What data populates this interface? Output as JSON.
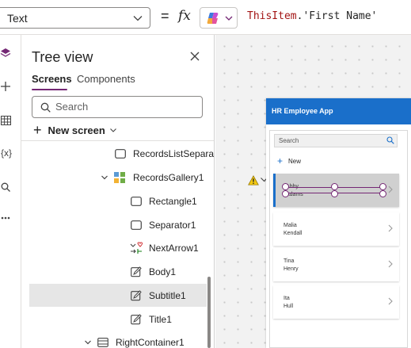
{
  "formula_bar": {
    "property": "Text",
    "equals": "=",
    "fx": "fx",
    "formula_keyword": "ThisItem",
    "formula_rest": ".'First Name'"
  },
  "rail": {
    "icons": [
      "layers-icon",
      "add-icon",
      "table-icon",
      "variables-icon",
      "search-icon",
      "more-icon"
    ],
    "variables_glyph": "{x}"
  },
  "tree": {
    "title": "Tree view",
    "tabs": {
      "screens": "Screens",
      "components": "Components"
    },
    "search_placeholder": "Search",
    "new_screen": "New screen",
    "items": [
      {
        "label": "RecordsListSeparato",
        "icon": "rectangle-icon"
      },
      {
        "label": "RecordsGallery1",
        "icon": "gallery-icon",
        "expanded": true
      },
      {
        "label": "Rectangle1",
        "icon": "rectangle-icon"
      },
      {
        "label": "Separator1",
        "icon": "rectangle-icon"
      },
      {
        "label": "NextArrow1",
        "icon": "icon-control-icon"
      },
      {
        "label": "Body1",
        "icon": "edit-label-icon"
      },
      {
        "label": "Subtitle1",
        "icon": "edit-label-icon",
        "selected": true
      },
      {
        "label": "Title1",
        "icon": "edit-label-icon"
      },
      {
        "label": "RightContainer1",
        "icon": "container-icon",
        "expanded": true
      }
    ]
  },
  "app": {
    "header_title": "HR Employee App",
    "search_placeholder": "Search",
    "new_label": "New",
    "employees": [
      {
        "first": "Abby",
        "last": "Adams"
      },
      {
        "first": "Malia",
        "last": "Kendall"
      },
      {
        "first": "Tina",
        "last": "Henry"
      },
      {
        "first": "Ita",
        "last": "Hull"
      }
    ]
  },
  "colors": {
    "accent": "#742774",
    "app_header": "#1a6fca",
    "warning": "#f2c811",
    "formula_keyword": "#a31515"
  }
}
